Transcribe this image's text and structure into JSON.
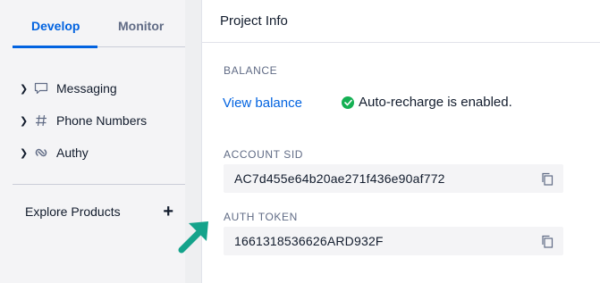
{
  "sidebar": {
    "tabs": [
      {
        "label": "Develop",
        "active": true
      },
      {
        "label": "Monitor",
        "active": false
      }
    ],
    "items": [
      {
        "label": "Messaging",
        "icon": "chat-bubble-icon"
      },
      {
        "label": "Phone Numbers",
        "icon": "hash-icon"
      },
      {
        "label": "Authy",
        "icon": "authy-icon"
      }
    ],
    "explore": {
      "label": "Explore Products",
      "icon": "plus-icon"
    }
  },
  "panel": {
    "title": "Project Info",
    "balance": {
      "label": "BALANCE",
      "link": "View balance",
      "status": "Auto-recharge is enabled.",
      "status_color": "#14b053"
    },
    "account_sid": {
      "label": "ACCOUNT SID",
      "value": "AC7d455e64b20ae271f436e90af772"
    },
    "auth_token": {
      "label": "AUTH TOKEN",
      "value": "1661318536626ARD932F"
    }
  },
  "colors": {
    "accent": "#0263e0",
    "annotation_arrow": "#14a38b"
  }
}
